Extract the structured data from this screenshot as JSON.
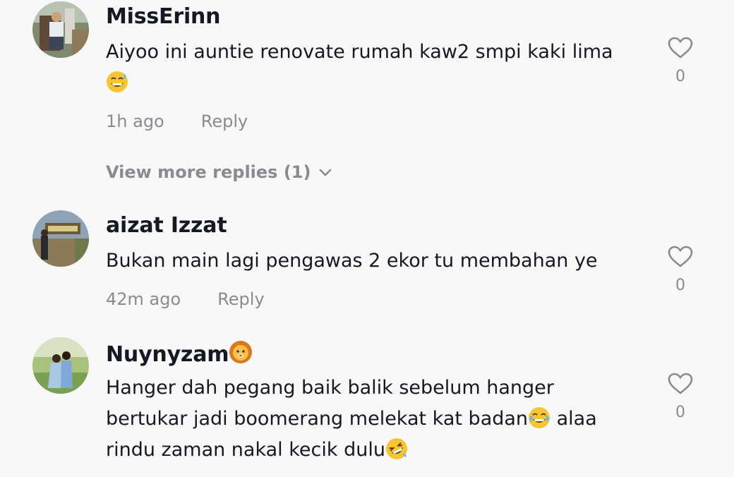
{
  "comments": [
    {
      "username": "MissErinn",
      "text_line1": "Aiyoo ini auntie renovate rumah kaw2 smpi kaki lima",
      "time": "1h ago",
      "reply_label": "Reply",
      "likes": "0",
      "emoji_name": "grinning-face-with-sweat-icon"
    },
    {
      "username": "aizat Izzat",
      "text_line1": "Bukan main lagi pengawas 2 ekor tu membahan ye",
      "time": "42m ago",
      "reply_label": "Reply",
      "likes": "0"
    },
    {
      "username": "Nuynyzam",
      "text_line1": "Hanger dah pegang baik balik sebelum hanger",
      "text_line2": "bertukar jadi boomerang melekat kat badan",
      "text_line2b": " alaa",
      "text_line3": "rindu zaman nakal kecik dulu",
      "likes": "0",
      "emoji_names": [
        "lion-face-icon",
        "face-with-tears-of-joy-icon",
        "rolling-on-floor-laughing-icon"
      ]
    }
  ],
  "view_more_replies": "View more replies (1)",
  "colors": {
    "background": "#f8f8f8",
    "primary_text": "#161823",
    "secondary_text": "#8a8b91"
  }
}
